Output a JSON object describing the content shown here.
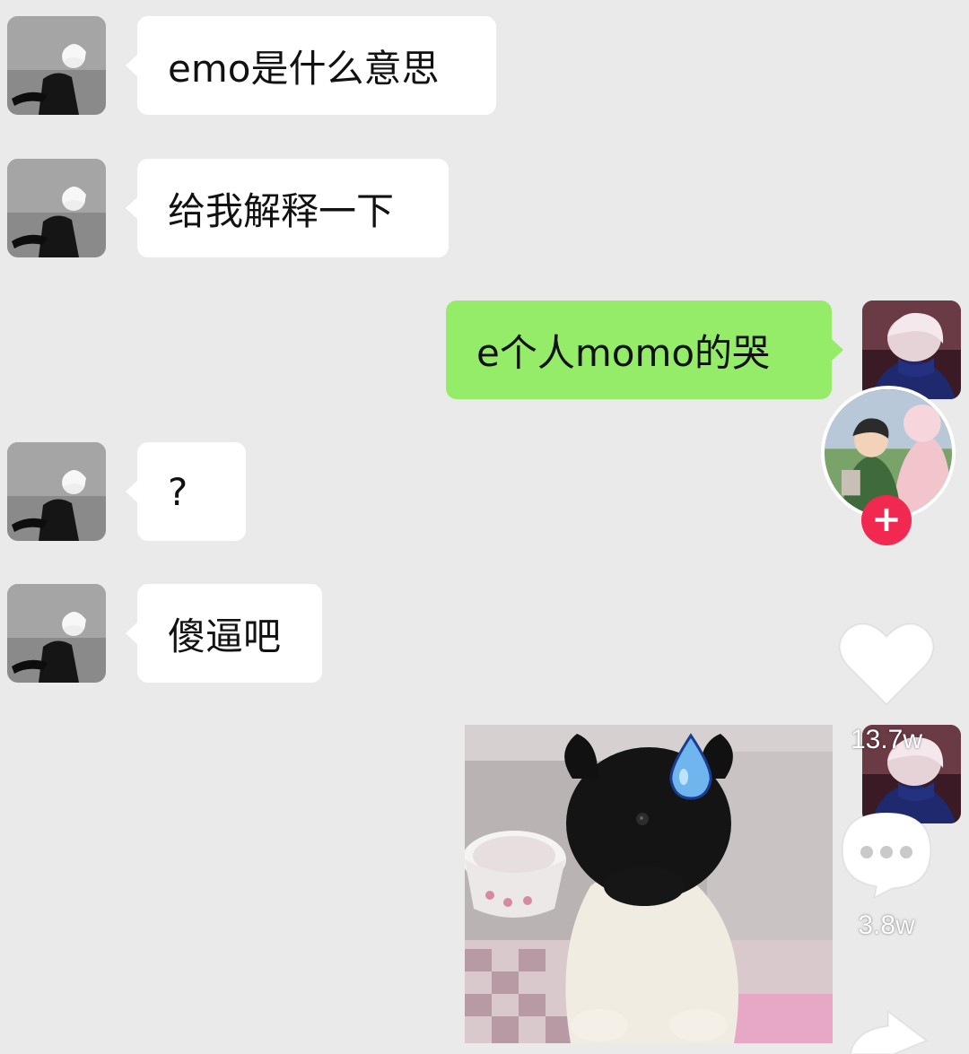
{
  "conversation": {
    "messages": [
      {
        "sender": "other",
        "type": "text",
        "text": "emo是什么意思"
      },
      {
        "sender": "other",
        "type": "text",
        "text": "给我解释一下"
      },
      {
        "sender": "me",
        "type": "text",
        "text": "e个人momo的哭"
      },
      {
        "sender": "other",
        "type": "text",
        "text": "?"
      },
      {
        "sender": "other",
        "type": "text",
        "text": "傻逼吧"
      },
      {
        "sender": "me",
        "type": "sticker",
        "sticker": "puppy-sweat-drop"
      }
    ]
  },
  "overlay": {
    "follow_symbol": "+",
    "like_count": "13.7w",
    "comment_count": "3.8w"
  },
  "colors": {
    "chat_background": "#ebeaeb",
    "incoming_bubble": "#ffffff",
    "outgoing_bubble": "#95ec69",
    "follow_button": "#f1284f"
  }
}
